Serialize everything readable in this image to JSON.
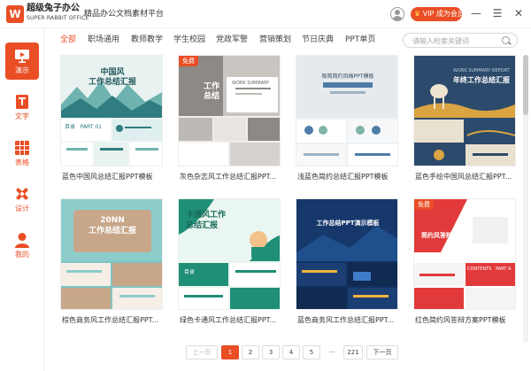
{
  "app": {
    "logo_letter": "W",
    "brand": "超级兔子办公",
    "brand_sub": "SUPER RABBIT OFFICE",
    "platform": "精品办公文档素材平台",
    "vip_label": "VIP 成为会员",
    "minimize": "—",
    "menu": "☰",
    "close": "✕"
  },
  "colors": {
    "accent": "#e94e25"
  },
  "sidebar": {
    "items": [
      {
        "label": "演示",
        "icon": "presentation-icon",
        "active": true
      },
      {
        "label": "文字",
        "icon": "text-document-icon",
        "active": false
      },
      {
        "label": "表格",
        "icon": "spreadsheet-icon",
        "active": false
      },
      {
        "label": "设计",
        "icon": "design-tools-icon",
        "active": false
      },
      {
        "label": "我的",
        "icon": "user-icon",
        "active": false
      }
    ]
  },
  "tabs": [
    {
      "label": "全部",
      "active": true
    },
    {
      "label": "职场通用",
      "active": false
    },
    {
      "label": "教师教学",
      "active": false
    },
    {
      "label": "学生校园",
      "active": false
    },
    {
      "label": "党政军警",
      "active": false
    },
    {
      "label": "营销策划",
      "active": false
    },
    {
      "label": "节日庆典",
      "active": false
    },
    {
      "label": "PPT单页",
      "active": false
    }
  ],
  "search": {
    "placeholder": "请输入检索关键词"
  },
  "cards": [
    {
      "caption": "蓝色中国风总结汇报PPT模板",
      "free": false,
      "thumb": {
        "title": "中国风\n工作总结汇报",
        "small": "目录   PART 01"
      }
    },
    {
      "caption": "灰色杂志风工作总结汇报PPT...",
      "free": true,
      "free_label": "免费",
      "thumb": {
        "title": "工作\n总结",
        "small": "WORK SUMMARY"
      }
    },
    {
      "caption": "浅蓝色简约总结汇报PPT模板",
      "free": false,
      "thumb": {
        "title": "极简简约风格PPT模板",
        "small": ""
      }
    },
    {
      "caption": "蓝色手绘中国风总结汇报PPT...",
      "free": false,
      "thumb": {
        "title": "年终工作总结汇报",
        "small": "WORK SUMMARY REPORT"
      }
    },
    {
      "caption": "棕色商务风工作总结汇报PPT...",
      "free": false,
      "thumb": {
        "title": "20NN\n工作总结汇报",
        "small": ""
      }
    },
    {
      "caption": "绿色卡通风工作总结汇报PPT...",
      "free": false,
      "thumb": {
        "title": "卡通风工作\n总结汇报",
        "small": "目录"
      }
    },
    {
      "caption": "蓝色商务风工作总结汇报PPT...",
      "free": false,
      "thumb": {
        "title": "工作总结PPT演示模板",
        "small": ""
      }
    },
    {
      "caption": "红色简约风答辩方案PPT模板",
      "free": true,
      "free_label": "免费",
      "thumb": {
        "title": "简约风答辩方案",
        "small": "CONTENTS   PART A"
      }
    }
  ],
  "pagination": {
    "prev": "上一页",
    "pages": [
      "1",
      "2",
      "3",
      "4",
      "5",
      "···",
      "221"
    ],
    "current": "1",
    "next": "下一页"
  }
}
